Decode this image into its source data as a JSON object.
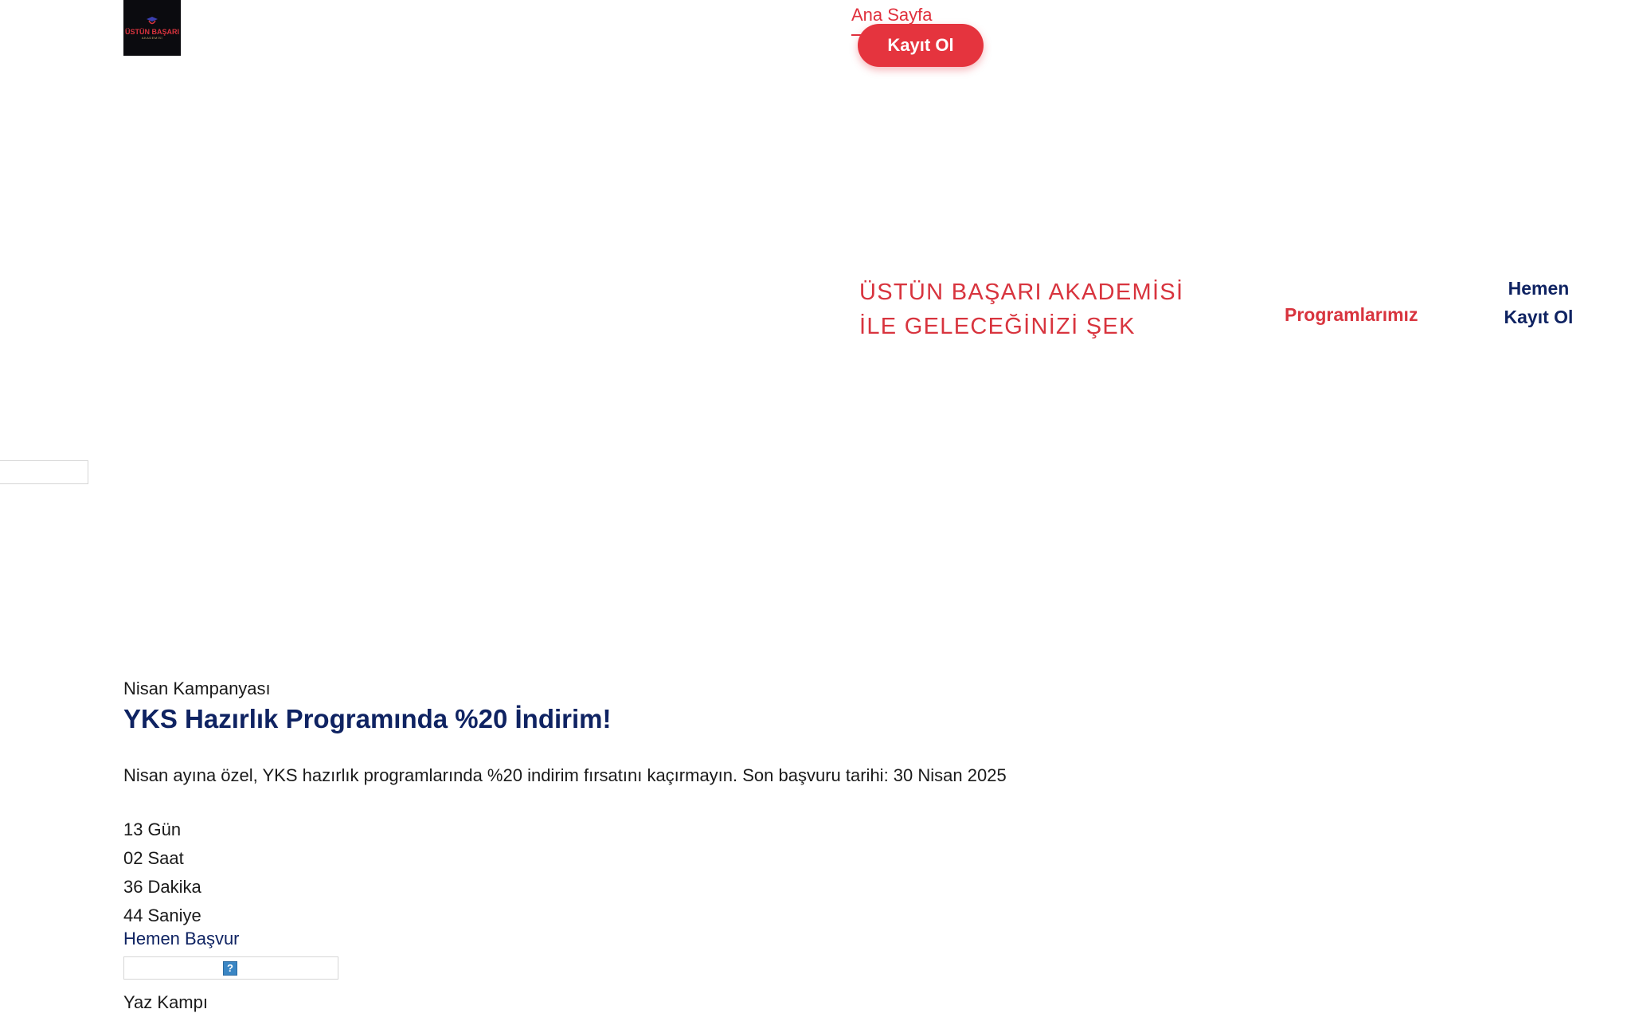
{
  "header": {
    "logo": {
      "text": "ÜSTÜN BAŞARI",
      "subtext": "AKADEMİSİ",
      "icon": "graduation-logo-icon"
    },
    "nav": {
      "home_label": "Ana Sayfa"
    },
    "register_button_label": "Kayıt Ol"
  },
  "hero": {
    "title": "ÜSTÜN BAŞARI AKADEMİSİ İLE GELECEĞİNİZİ ŞEK",
    "programs_link": "Programlarımız",
    "cta_link": "Hemen Kayıt Ol"
  },
  "campaign": {
    "label": "Nisan Kampanyası",
    "title": "YKS Hazırlık Programında %20 İndirim!",
    "description": "Nisan ayına özel, YKS hazırlık programlarında %20 indirim fırsatını kaçırmayın. Son başvuru tarihi: 30 Nisan 2025",
    "countdown": [
      {
        "value": "13",
        "unit": "Gün"
      },
      {
        "value": "02",
        "unit": "Saat"
      },
      {
        "value": "36",
        "unit": "Dakika"
      },
      {
        "value": "44",
        "unit": "Saniye"
      }
    ],
    "apply_link": "Hemen Başvur",
    "broken_image_icon": "broken-image-icon",
    "broken_image_glyph": "?"
  },
  "next_section": {
    "label": "Yaz Kampı"
  },
  "colors": {
    "brand_red": "#e5343e",
    "brand_navy": "#0f2362",
    "text": "#1a1a1a"
  }
}
